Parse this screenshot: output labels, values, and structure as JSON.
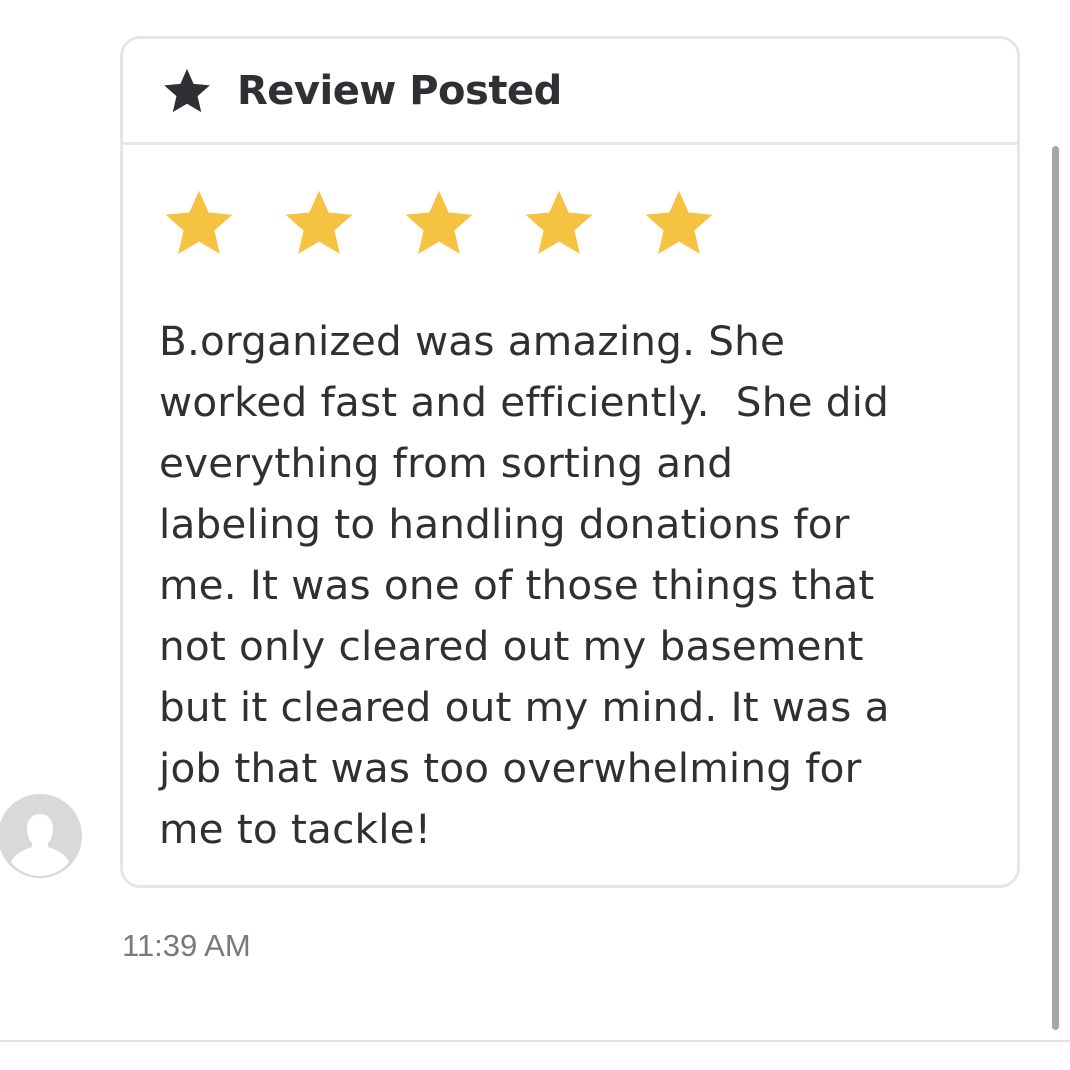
{
  "header": {
    "icon": "star-icon",
    "title": "Review Posted"
  },
  "rating": {
    "value": 5,
    "max": 5,
    "color": "#F5C242"
  },
  "review": {
    "text": "B.organized was amazing. She\nworked fast and efficiently.  She did\neverything from sorting and\nlabeling to handling donations for\nme. It was one of those things that\nnot only cleared out my basement\nbut it cleared out my mind. It was a\njob that was too overwhelming for\nme to tackle!"
  },
  "message": {
    "timestamp": "11:39 AM",
    "avatar_icon": "user-avatar-icon"
  },
  "colors": {
    "text": "#2F3033",
    "border": "#E6E6E8",
    "timestamp": "#77797D",
    "avatar": "#D9D9D9"
  }
}
